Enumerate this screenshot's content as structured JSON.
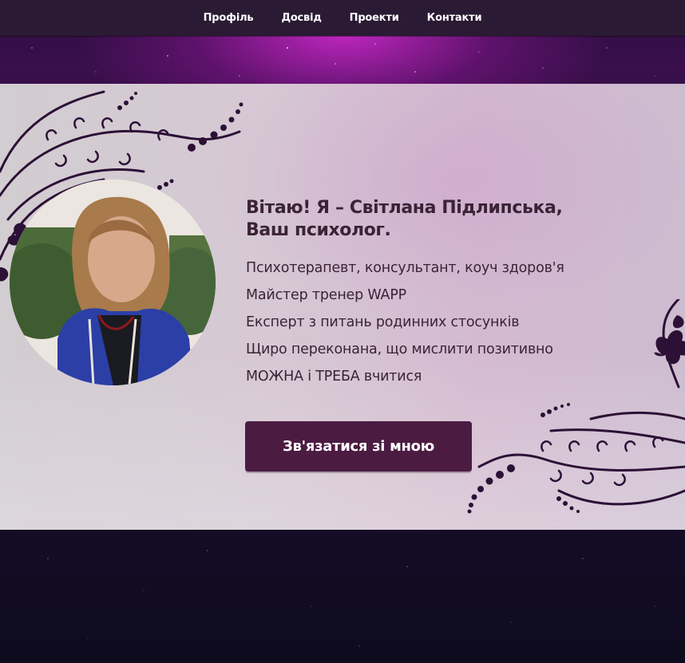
{
  "nav": {
    "items": [
      "Профіль",
      "Досвід",
      "Проекти",
      "Контакти"
    ]
  },
  "hero": {
    "title_line1": "Вітаю! Я – Світлана Підлипська,",
    "title_line2": "Ваш психолог.",
    "lines": [
      "Психотерапевт, консультант, коуч здоров'я",
      "Майстер тренер WAPP",
      "Експерт з питань родинних стосунків",
      "Щиро переконана, що мислити позитивно",
      "МОЖНА і ТРЕБА вчитися"
    ],
    "button_label": "Зв'язатися зі мною",
    "photo": "portrait-photo"
  },
  "colors": {
    "navbar_bg": "#2a1a33",
    "button_bg": "#4c1b42",
    "text_dark": "#3b2336",
    "ornament": "#2c1036"
  },
  "icons": [
    "floral-ornament-left",
    "floral-ornament-right"
  ]
}
